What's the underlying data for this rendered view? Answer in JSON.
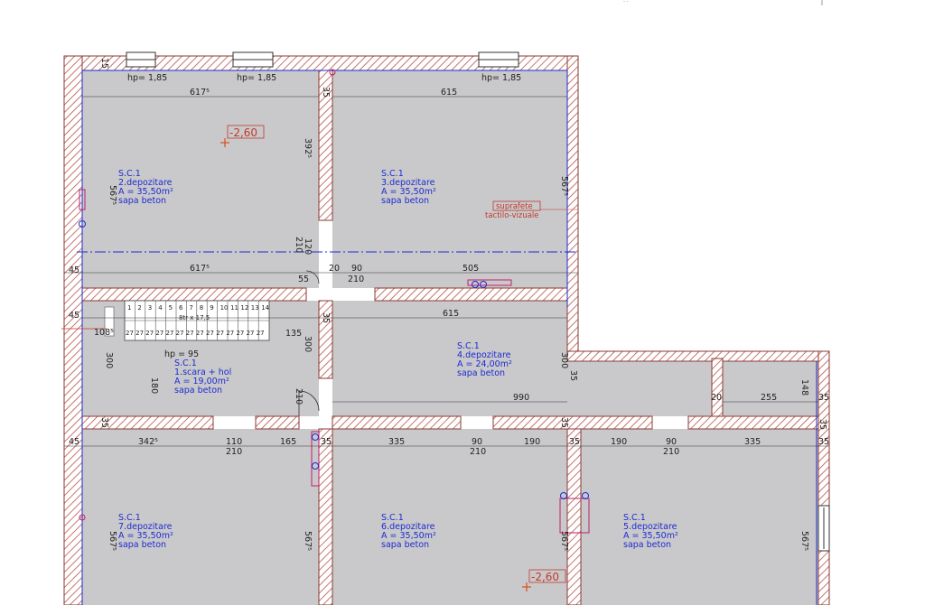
{
  "rooms": [
    {
      "code": "S.C.1",
      "name": "2.depozitare",
      "area": "A = 35,50m²",
      "finish": "sapa beton"
    },
    {
      "code": "S.C.1",
      "name": "3.depozitare",
      "area": "A = 35,50m²",
      "finish": "sapa beton"
    },
    {
      "code": "S.C.1",
      "name": "1.scara + hol",
      "area": "A = 19,00m²",
      "finish": "sapa beton"
    },
    {
      "code": "S.C.1",
      "name": "4.depozitare",
      "area": "A = 24,00m²",
      "finish": "sapa beton"
    },
    {
      "code": "S.C.1",
      "name": "7.depozitare",
      "area": "A = 35,50m²",
      "finish": "sapa beton"
    },
    {
      "code": "S.C.1",
      "name": "6.depozitare",
      "area": "A = 35,50m²",
      "finish": "sapa beton"
    },
    {
      "code": "S.C.1",
      "name": "5.depozitare",
      "area": "A = 35,50m²",
      "finish": "sapa beton"
    }
  ],
  "levels": [
    "-2,60",
    "-2,60"
  ],
  "window_heights": [
    "hp= 1,85",
    "hp= 1,85",
    "hp= 1,85",
    "hp = 95"
  ],
  "note": {
    "line1": "suprafete",
    "line2": "tactilo-vizuale"
  },
  "dimensions": {
    "top_row": [
      "617⁵",
      "615"
    ],
    "mid_row": [
      "617⁵",
      "20",
      "90",
      "210",
      "505"
    ],
    "hall_row": [
      "615",
      "990",
      "20",
      "255"
    ],
    "lower_row": [
      "342⁵",
      "110",
      "210",
      "165",
      "335",
      "90",
      "210",
      "190",
      "190",
      "90",
      "210",
      "335"
    ],
    "verticals": [
      "567⁵",
      "392⁵",
      "567⁵",
      "120",
      "210",
      "300",
      "180",
      "300",
      "300",
      "210",
      "148",
      "567⁵",
      "567⁵",
      "567⁵",
      "567⁵",
      "135"
    ],
    "walls": [
      "45",
      "15",
      "35",
      "55",
      "45",
      "35",
      "35",
      "45",
      "35",
      "35",
      "35",
      "35",
      "35",
      "35",
      "35",
      "108⁵"
    ],
    "stair_treads": [
      "1",
      "2",
      "3",
      "4",
      "5",
      "6",
      "7",
      "8",
      "9",
      "10",
      "11",
      "12",
      "13",
      "14"
    ],
    "stair_run": "27 27 27 27 27 27 27 27 27 27 27 27 27 27",
    "stair_label": "8tr x 17,5"
  }
}
